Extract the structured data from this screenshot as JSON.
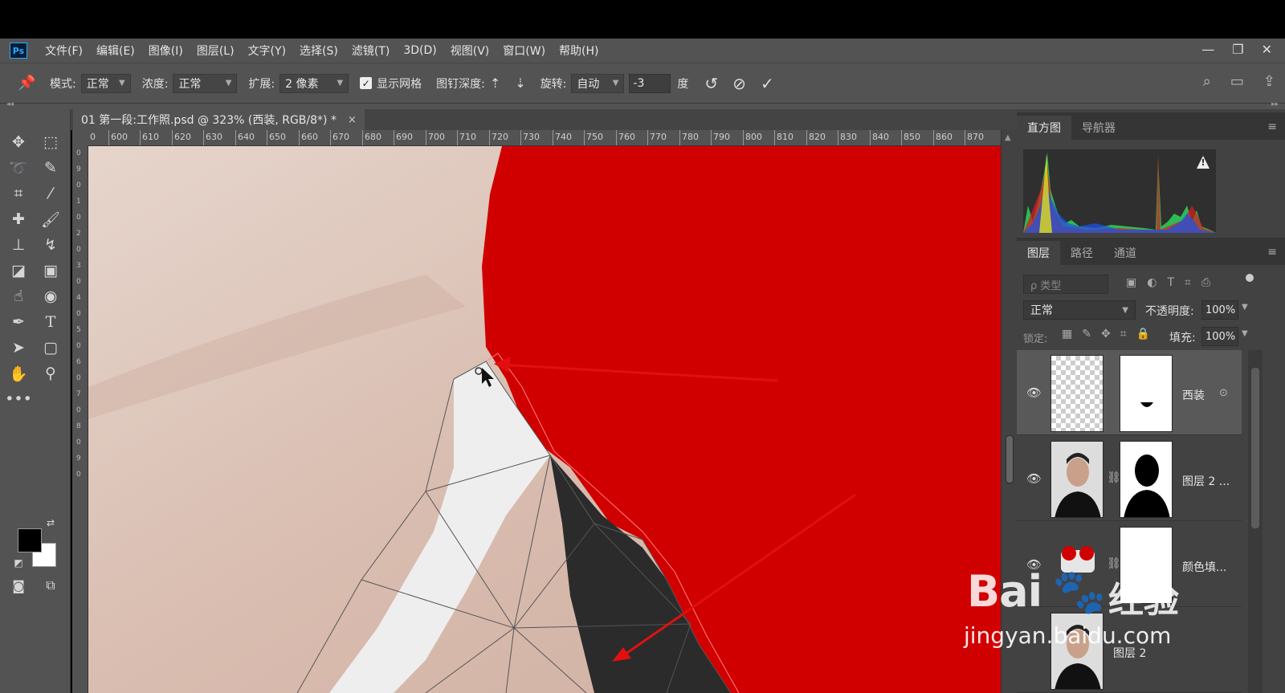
{
  "app": {
    "logo": "Ps"
  },
  "menu": [
    "文件(F)",
    "编辑(E)",
    "图像(I)",
    "图层(L)",
    "文字(Y)",
    "选择(S)",
    "滤镜(T)",
    "3D(D)",
    "视图(V)",
    "窗口(W)",
    "帮助(H)"
  ],
  "window_controls": {
    "minimize": "—",
    "restore": "❐",
    "close": "✕"
  },
  "options": {
    "mode_label": "模式:",
    "mode_value": "正常",
    "density_label": "浓度:",
    "density_value": "正常",
    "expand_label": "扩展:",
    "expand_value": "2 像素",
    "show_mesh_label": "显示网格",
    "show_mesh_checked": true,
    "pin_depth_label": "图钉深度:",
    "rotate_label": "旋转:",
    "rotate_value": "自动",
    "rotate_angle": "-3",
    "degree_label": "度"
  },
  "document": {
    "tab_title": "01 第一段:工作照.psd @ 323% (西装, RGB/8*) *",
    "close_symbol": "×"
  },
  "ruler_h": [
    "0",
    "600",
    "610",
    "620",
    "630",
    "640",
    "650",
    "660",
    "670",
    "680",
    "690",
    "700",
    "710",
    "720",
    "730",
    "740",
    "750",
    "760",
    "770",
    "780",
    "790",
    "800",
    "810",
    "820",
    "830",
    "840",
    "850",
    "860",
    "870"
  ],
  "panels": {
    "top_tabs": [
      "直方图",
      "导航器"
    ],
    "layer_tabs": [
      "图层",
      "路径",
      "通道"
    ],
    "filter_placeholder": "ρ 类型",
    "blend_mode": "正常",
    "opacity_label": "不透明度:",
    "opacity_value": "100%",
    "lock_label": "锁定:",
    "fill_label": "填充:",
    "fill_value": "100%"
  },
  "layers": [
    {
      "name": "西装",
      "visible": true,
      "selected": true
    },
    {
      "name": "图层 2 ...",
      "visible": true,
      "selected": false
    },
    {
      "name": "颜色填...",
      "visible": true,
      "selected": false
    },
    {
      "name": "图层 2",
      "visible": false,
      "selected": false
    }
  ],
  "watermark": {
    "brand": "Bai",
    "product": "经验",
    "url": "jingyan.baidu.com"
  },
  "colors": {
    "red_background": "#d10000",
    "skin": "#dcc1b5",
    "ui_gray": "#535353",
    "arrow": "#e01010"
  },
  "icons": [
    "move-icon",
    "marquee-icon",
    "lasso-icon",
    "quick-select-icon",
    "crop-icon",
    "eyedropper-icon",
    "healing-icon",
    "brush-icon",
    "stamp-icon",
    "history-brush-icon",
    "eraser-icon",
    "gradient-icon",
    "smudge-icon",
    "dodge-icon",
    "pen-icon",
    "type-icon",
    "path-select-icon",
    "shape-icon",
    "hand-icon",
    "zoom-icon",
    "more-tools-icon"
  ]
}
